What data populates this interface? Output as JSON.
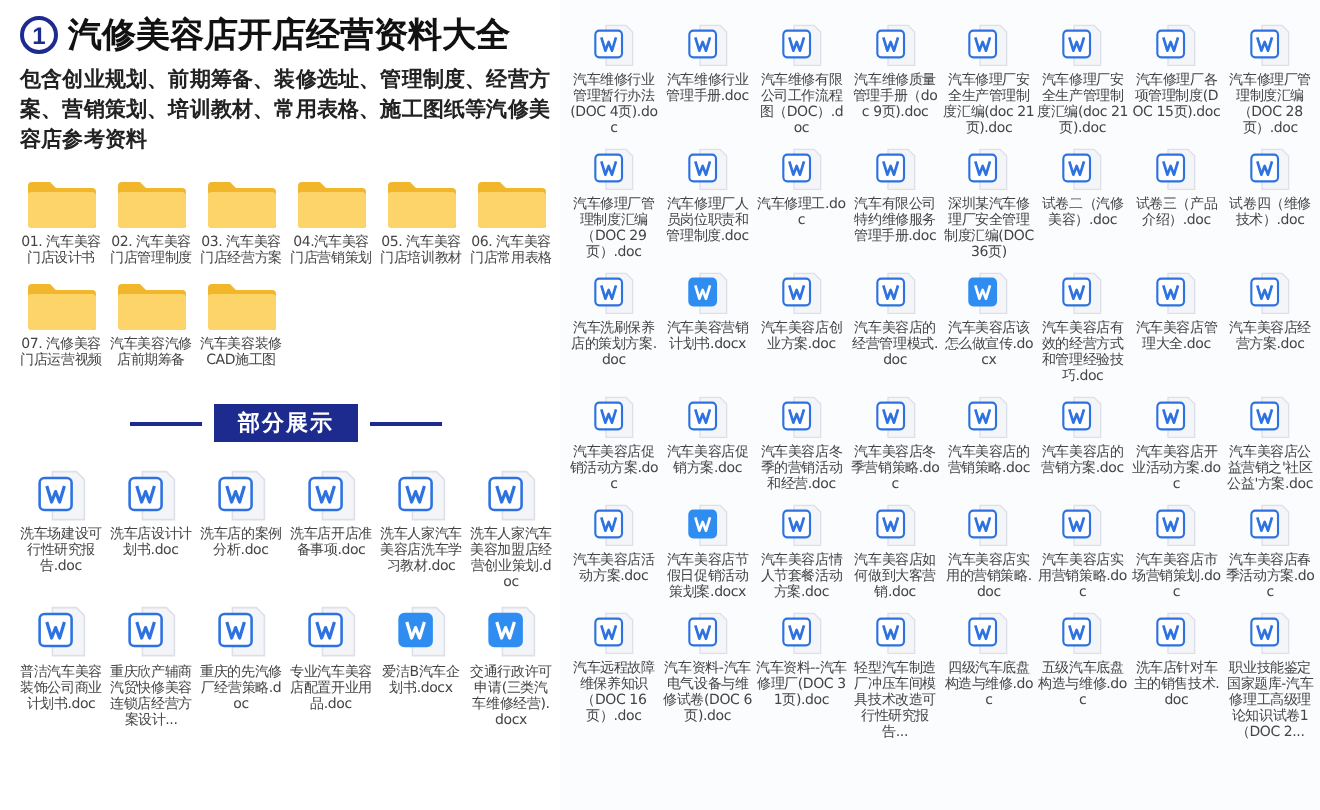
{
  "header": {
    "number": "1",
    "title": "汽修美容店开店经营资料大全",
    "description": "包含创业规划、前期筹备、装修选址、管理制度、经营方案、营销策划、培训教材、常用表格、施工图纸等汽修美容店参考资料"
  },
  "folders": [
    {
      "name": "01. 汽车美容门店设计书"
    },
    {
      "name": "02. 汽车美容门店管理制度"
    },
    {
      "name": "03. 汽车美容门店经营方案"
    },
    {
      "name": "04.汽车美容门店营销策划"
    },
    {
      "name": "05. 汽车美容门店培训教材"
    },
    {
      "name": "06. 汽车美容门店常用表格"
    },
    {
      "name": "07. 汽修美容门店运营视频"
    },
    {
      "name": "汽车美容汽修店前期筹备"
    },
    {
      "name": "汽车美容装修CAD施工图"
    }
  ],
  "section_label": "部分展示",
  "sample_files": [
    {
      "name": "洗车场建设可行性研究报告.doc",
      "kind": "doc"
    },
    {
      "name": "洗车店设计计划书.doc",
      "kind": "doc"
    },
    {
      "name": "洗车店的案例分析.doc",
      "kind": "doc"
    },
    {
      "name": "洗车店开店准备事项.doc",
      "kind": "doc"
    },
    {
      "name": "洗车人家汽车美容店洗车学习教材.doc",
      "kind": "doc"
    },
    {
      "name": "洗车人家汽车美容加盟店经营创业策划.doc",
      "kind": "doc"
    },
    {
      "name": "普洁汽车美容装饰公司商业计划书.doc",
      "kind": "doc"
    },
    {
      "name": "重庆欣产辅商汽贸快修美容连锁店经营方案设计...",
      "kind": "doc"
    },
    {
      "name": "重庆的先汽修厂经营策略.doc",
      "kind": "doc"
    },
    {
      "name": "专业汽车美容店配置开业用品.doc",
      "kind": "doc"
    },
    {
      "name": "爱洁B汽车企划书.docx",
      "kind": "docx"
    },
    {
      "name": "交通行政许可申请(三类汽车维修经营).docx",
      "kind": "docx"
    }
  ],
  "files": [
    {
      "name": "汽车维修行业管理暂行办法(DOC 4页).doc",
      "kind": "doc"
    },
    {
      "name": "汽车维修行业管理手册.doc",
      "kind": "doc"
    },
    {
      "name": "汽车维修有限公司工作流程图（DOC）.doc",
      "kind": "doc"
    },
    {
      "name": "汽车维修质量管理手册（doc 9页).doc",
      "kind": "doc"
    },
    {
      "name": "汽车修理厂安全生产管理制度汇编(doc 21页).doc",
      "kind": "doc"
    },
    {
      "name": "汽车修理厂安全生产管理制度汇编(doc 21页).doc",
      "kind": "doc"
    },
    {
      "name": "汽车修理厂各项管理制度(DOC 15页).doc",
      "kind": "doc"
    },
    {
      "name": "汽车修理厂管理制度汇编（DOC 28页）.doc",
      "kind": "doc"
    },
    {
      "name": "汽车修理厂管理制度汇编（DOC 29页）.doc",
      "kind": "doc"
    },
    {
      "name": "汽车修理厂人员岗位职责和管理制度.doc",
      "kind": "doc"
    },
    {
      "name": "汽车修理工.doc",
      "kind": "doc"
    },
    {
      "name": "汽车有限公司特约维修服务管理手册.doc",
      "kind": "doc"
    },
    {
      "name": "深圳某汽车修理厂安全管理制度汇编(DOC 36页)",
      "kind": "doc"
    },
    {
      "name": "试卷二（汽修美容）.doc",
      "kind": "doc"
    },
    {
      "name": "试卷三（产品介绍）.doc",
      "kind": "doc"
    },
    {
      "name": "试卷四（维修技术）.doc",
      "kind": "doc"
    },
    {
      "name": "汽车洗刷保养店的策划方案.doc",
      "kind": "doc"
    },
    {
      "name": "汽车美容营销计划书.docx",
      "kind": "docx"
    },
    {
      "name": "汽车美容店创业方案.doc",
      "kind": "doc"
    },
    {
      "name": "汽车美容店的经营管理模式.doc",
      "kind": "doc"
    },
    {
      "name": "汽车美容店该怎么做宣传.docx",
      "kind": "docx"
    },
    {
      "name": "汽车美容店有效的经营方式和管理经验技巧.doc",
      "kind": "doc"
    },
    {
      "name": "汽车美容店管理大全.doc",
      "kind": "doc"
    },
    {
      "name": "汽车美容店经营方案.doc",
      "kind": "doc"
    },
    {
      "name": "汽车美容店促销活动方案.doc",
      "kind": "doc"
    },
    {
      "name": "汽车美容店促销方案.doc",
      "kind": "doc"
    },
    {
      "name": "汽车美容店冬季的营销活动和经营.doc",
      "kind": "doc"
    },
    {
      "name": "汽车美容店冬季营销策略.doc",
      "kind": "doc"
    },
    {
      "name": "汽车美容店的营销策略.doc",
      "kind": "doc"
    },
    {
      "name": "汽车美容店的营销方案.doc",
      "kind": "doc"
    },
    {
      "name": "汽车美容店开业活动方案.doc",
      "kind": "doc"
    },
    {
      "name": "汽车美容店公益营销之'社区公益'方案.doc",
      "kind": "doc"
    },
    {
      "name": "汽车美容店活动方案.doc",
      "kind": "doc"
    },
    {
      "name": "汽车美容店节假日促销活动策划案.docx",
      "kind": "docx"
    },
    {
      "name": "汽车美容店情人节套餐活动方案.doc",
      "kind": "doc"
    },
    {
      "name": "汽车美容店如何做到大客营销.doc",
      "kind": "doc"
    },
    {
      "name": "汽车美容店实用的营销策略.doc",
      "kind": "doc"
    },
    {
      "name": "汽车美容店实用营销策略.doc",
      "kind": "doc"
    },
    {
      "name": "汽车美容店市场营销策划.doc",
      "kind": "doc"
    },
    {
      "name": "汽车美容店春季活动方案.doc",
      "kind": "doc"
    },
    {
      "name": "汽车远程故障维保养知识（DOC 16页）.doc",
      "kind": "doc"
    },
    {
      "name": "汽车资料-汽车电气设备与维修试卷(DOC 6页).doc",
      "kind": "doc"
    },
    {
      "name": "汽车资料--汽车修理厂(DOC 31页).doc",
      "kind": "doc"
    },
    {
      "name": "轻型汽车制造厂冲压车间模具技术改造可行性研究报告...",
      "kind": "doc"
    },
    {
      "name": "四级汽车底盘构造与维修.doc",
      "kind": "doc"
    },
    {
      "name": "五级汽车底盘构造与维修.doc",
      "kind": "doc"
    },
    {
      "name": "洗车店针对车主的销售技术.doc",
      "kind": "doc"
    },
    {
      "name": "职业技能鉴定国家题库-汽车修理工高级理论知识试卷1（DOC 2...",
      "kind": "doc"
    }
  ]
}
